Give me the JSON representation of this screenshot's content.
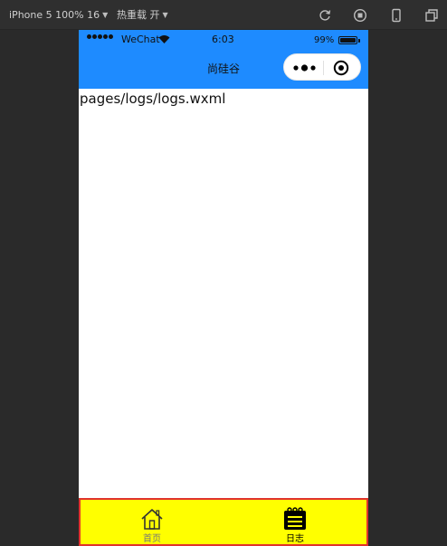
{
  "devtools": {
    "device_label": "iPhone 5 100% 16",
    "hot_reload_label": "热重载 开",
    "icons": [
      "refresh-icon",
      "stop-icon",
      "phone-preview-icon",
      "window-icon"
    ]
  },
  "status_bar": {
    "carrier": "WeChat",
    "time": "6:03",
    "battery": "99%",
    "battery_level": 0.99
  },
  "nav_bar": {
    "title": "尚硅谷",
    "background": "#1e8bff",
    "capsule_icons": [
      "more-icon",
      "close-icon"
    ]
  },
  "page": {
    "text": "pages/logs/logs.wxml"
  },
  "tab_bar": {
    "background": "#ffff00",
    "border_color": "#e0332c",
    "tabs": [
      {
        "label": "首页",
        "icon": "home-icon",
        "selected": false,
        "color": "#777777"
      },
      {
        "label": "日志",
        "icon": "log-icon",
        "selected": true,
        "color": "#000000"
      }
    ]
  }
}
